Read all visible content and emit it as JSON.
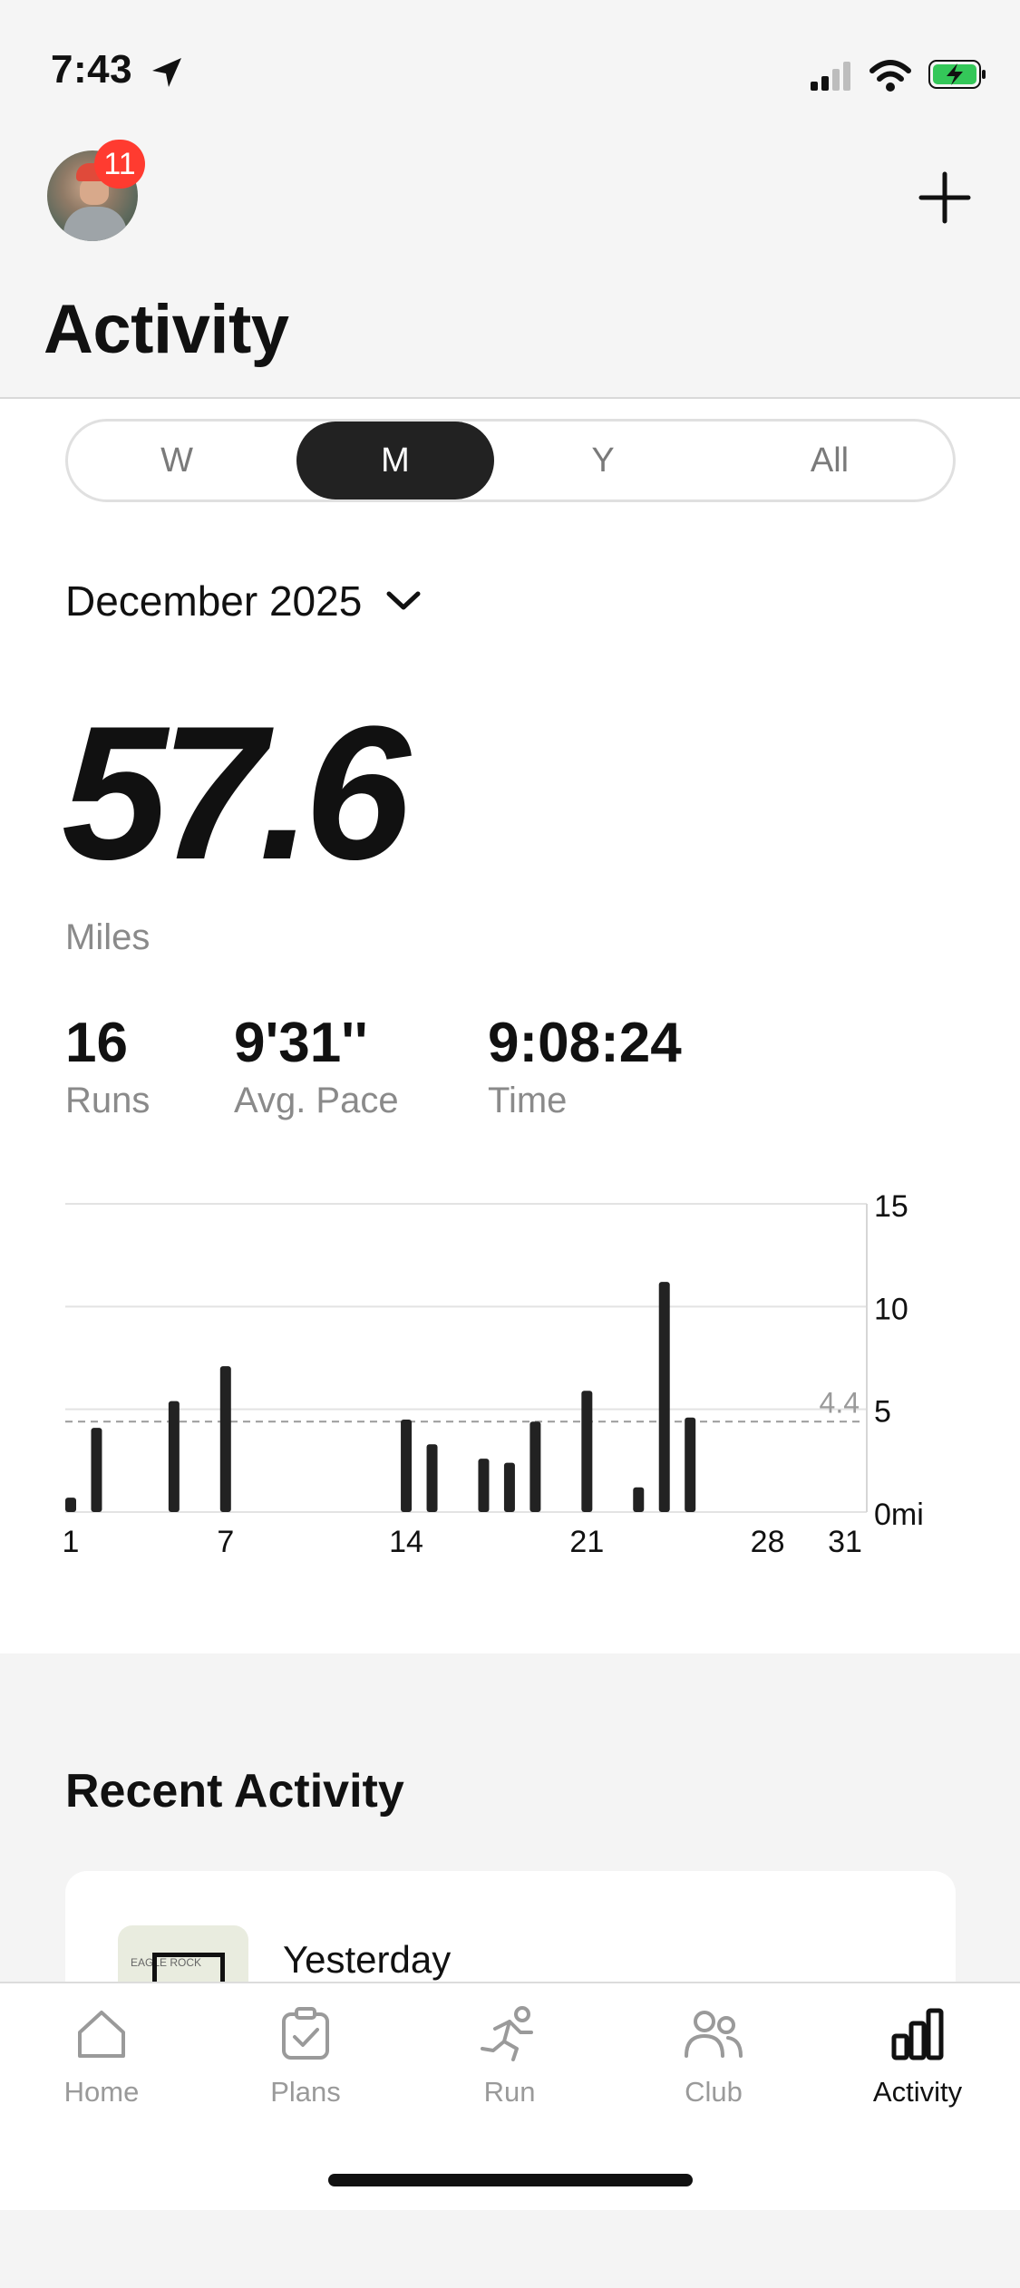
{
  "status_bar": {
    "time": "7:43"
  },
  "header": {
    "title": "Activity",
    "notification_count": "11"
  },
  "period_tabs": [
    {
      "label": "W",
      "active": false
    },
    {
      "label": "M",
      "active": true
    },
    {
      "label": "Y",
      "active": false
    },
    {
      "label": "All",
      "active": false
    }
  ],
  "month_selector": {
    "label": "December 2025"
  },
  "summary": {
    "total": "57.6",
    "unit": "Miles",
    "stats": [
      {
        "value": "16",
        "label": "Runs"
      },
      {
        "value": "9'31''",
        "label": "Avg. Pace"
      },
      {
        "value": "9:08:24",
        "label": "Time"
      }
    ]
  },
  "chart_data": {
    "type": "bar",
    "x": [
      1,
      2,
      5,
      7,
      14,
      15,
      17,
      18,
      19,
      21,
      23,
      24,
      25
    ],
    "values": [
      0.7,
      4.1,
      5.4,
      7.1,
      4.5,
      3.3,
      2.6,
      2.4,
      4.4,
      5.9,
      1.2,
      11.2,
      4.6
    ],
    "xlim": [
      1,
      31
    ],
    "ylim": [
      0,
      15
    ],
    "x_ticks": [
      "1",
      "7",
      "14",
      "21",
      "28",
      "31"
    ],
    "y_ticks": [
      "15",
      "10",
      "5",
      "0mi"
    ],
    "average": 4.4,
    "average_label": "4.4",
    "grid": true,
    "color": "#222222"
  },
  "recent": {
    "title": "Recent Activity",
    "first_item_date": "Yesterday",
    "map_label": "EAGLE ROCK"
  },
  "tabbar": [
    {
      "label": "Home",
      "icon": "home-icon",
      "active": false
    },
    {
      "label": "Plans",
      "icon": "clipboard-check-icon",
      "active": false
    },
    {
      "label": "Run",
      "icon": "runner-icon",
      "active": false
    },
    {
      "label": "Club",
      "icon": "club-people-icon",
      "active": false
    },
    {
      "label": "Activity",
      "icon": "bar-chart-icon",
      "active": true
    }
  ]
}
